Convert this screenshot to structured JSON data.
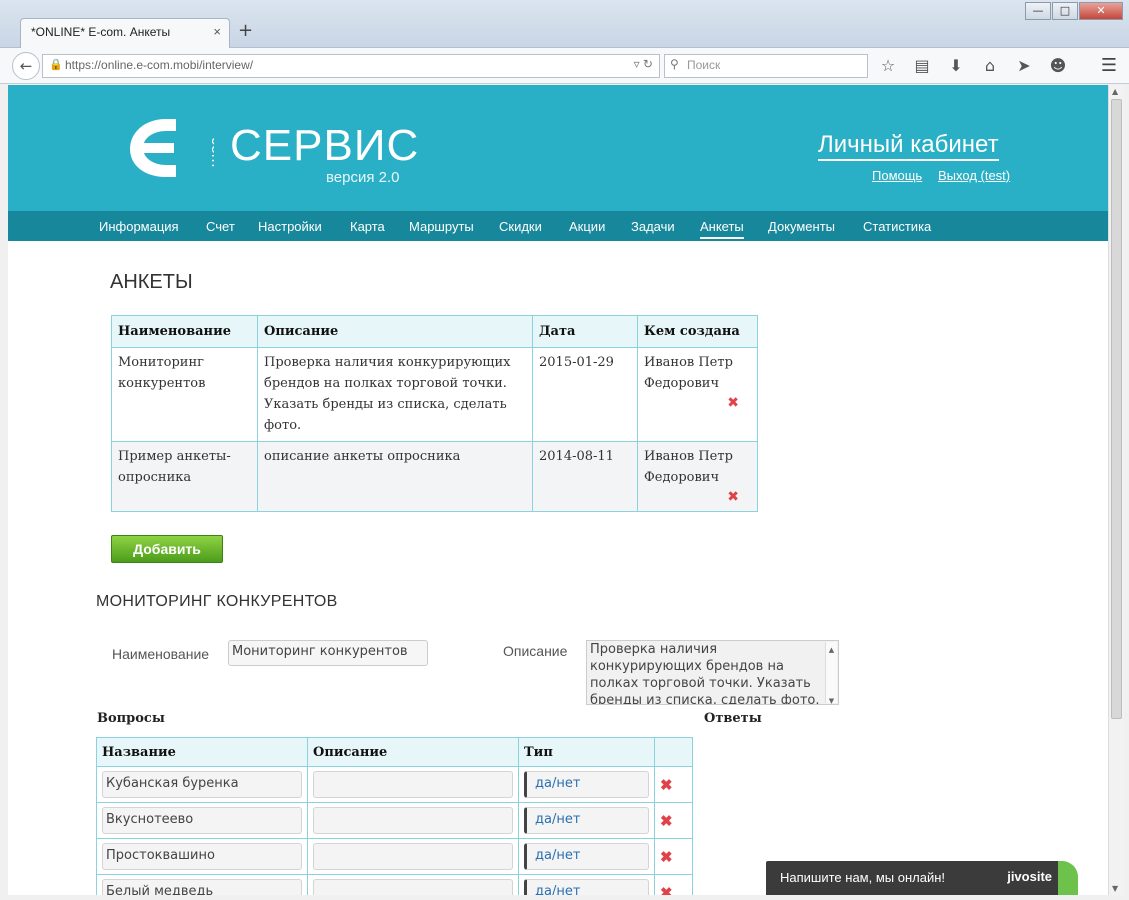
{
  "browser": {
    "tab_title": "*ONLINE* E-com. Анкеты",
    "tab_close": "×",
    "new_tab": "+",
    "url": "https://online.e-com.mobi/interview/",
    "search_placeholder": "Поиск",
    "window_buttons": [
      "—",
      "□",
      "✕"
    ]
  },
  "header": {
    "brand_title": "СЕРВИС",
    "brand_version": "версия 2.0",
    "cabinet_link": "Личный кабинет",
    "help_link": "Помощь",
    "logout_link": "Выход (test)",
    "accent_color": "#2ab0c6",
    "nav_color": "#17879b"
  },
  "nav": {
    "items": [
      "Информация",
      "Счет",
      "Настройки",
      "Карта",
      "Маршруты",
      "Скидки",
      "Акции",
      "Задачи",
      "Анкеты",
      "Документы",
      "Статистика"
    ],
    "active": "Анкеты"
  },
  "page_title": "АНКЕТЫ",
  "forms_table": {
    "headers": [
      "Наименование",
      "Описание",
      "Дата",
      "Кем создана"
    ],
    "rows": [
      {
        "name": "Мониторинг конкурентов",
        "description": "Проверка наличия конкурирующих брендов на полках торговой точки. Указать бренды из списка, сделать фото.",
        "date": "2015-01-29",
        "author": "Иванов Петр Федорович",
        "delete": "✖"
      },
      {
        "name": "Пример анкеты-опросника",
        "description": "описание анкеты опросника",
        "date": "2014-08-11",
        "author": "Иванов Петр Федорович",
        "delete": "✖"
      }
    ]
  },
  "add_button": "Добавить",
  "detail": {
    "title": "МОНИТОРИНГ КОНКУРЕНТОВ",
    "name_label": "Наименование",
    "name_value": "Мониторинг конкурентов",
    "description_label": "Описание",
    "description_value": "Проверка наличия конкурирующих брендов на полках торговой точки. Указать бренды из списка, сделать фото.",
    "questions_label": "Вопросы",
    "answers_label": "Ответы"
  },
  "questions_table": {
    "headers": [
      "Название",
      "Описание",
      "Тип",
      ""
    ],
    "rows": [
      {
        "name": "Кубанская буренка",
        "description": "",
        "type": "да/нет",
        "delete": "✖"
      },
      {
        "name": "Вкуснотеево",
        "description": "",
        "type": "да/нет",
        "delete": "✖"
      },
      {
        "name": "Простоквашино",
        "description": "",
        "type": "да/нет",
        "delete": "✖"
      },
      {
        "name": "Белый медведь",
        "description": "",
        "type": "да/нет",
        "delete": "✖"
      }
    ]
  },
  "chat": {
    "text": "Напишите нам, мы онлайн!",
    "brand": "jivosite"
  }
}
